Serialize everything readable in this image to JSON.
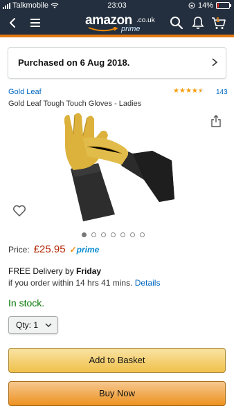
{
  "status_bar": {
    "carrier": "Talkmobile",
    "time": "23:03",
    "battery": "14%",
    "battery_level": 0.14
  },
  "header": {
    "logo_word": "amazon",
    "logo_tld": ".co.uk",
    "logo_sub": "prime",
    "cart_count": "1"
  },
  "purchase_notice": {
    "text": "Purchased on 6 Aug 2018."
  },
  "product": {
    "brand": "Gold Leaf",
    "title": "Gold Leaf Tough Touch Gloves - Ladies",
    "rating": 4.5,
    "review_count": "143",
    "image_count": 7,
    "active_image": 0
  },
  "price": {
    "label": "Price:",
    "value": "£25.95",
    "prime_label": "prime"
  },
  "delivery": {
    "prefix": "FREE Delivery by ",
    "day": "Friday",
    "detail": "if you order within 14 hrs 41 mins.",
    "details_link": "Details"
  },
  "stock": {
    "text": "In stock."
  },
  "quantity": {
    "label": "Qty:",
    "value": "1"
  },
  "buttons": {
    "add_to_basket": "Add to Basket",
    "buy_now": "Buy Now"
  },
  "colors": {
    "header_bg": "#232f3e",
    "accent_orange": "#e47911",
    "price_red": "#b12704",
    "link_blue": "#0066c0",
    "stock_green": "#007600"
  }
}
